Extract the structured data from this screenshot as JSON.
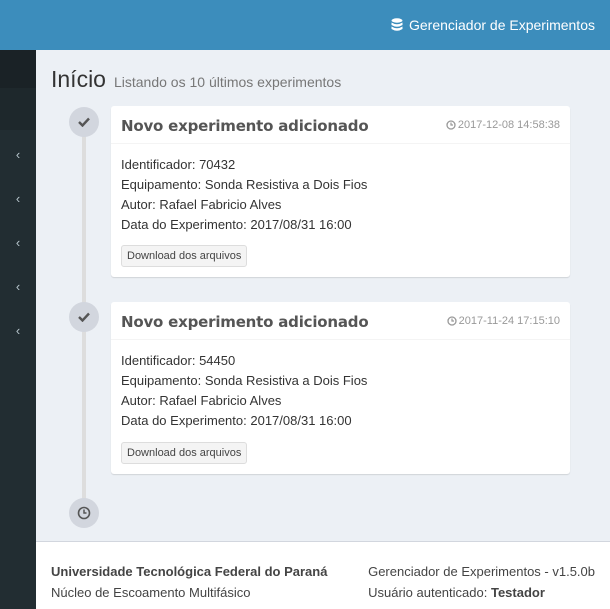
{
  "header": {
    "brand_label": "Gerenciador de Experimentos",
    "brand_icon": "database-icon",
    "color": "#3c8dbc"
  },
  "sidebar": {
    "items": [
      "chevron-left-icon",
      "chevron-left-icon",
      "chevron-left-icon",
      "chevron-left-icon",
      "chevron-left-icon"
    ],
    "bg": "#222d32"
  },
  "page": {
    "title": "Início",
    "subtitle": "Listando os 10 últimos experimentos"
  },
  "timeline": [
    {
      "title": "Novo experimento adicionado",
      "time": "2017-12-08 14:58:38",
      "id_label": "Identificador:",
      "id_value": "70432",
      "equip_label": "Equipamento:",
      "equip_value": "Sonda Resistiva a Dois Fios",
      "author_label": "Autor:",
      "author_value": "Rafael Fabricio Alves",
      "date_label": "Data do Experimento:",
      "date_value": "2017/08/31 16:00",
      "button_label": "Download dos arquivos"
    },
    {
      "title": "Novo experimento adicionado",
      "time": "2017-11-24 17:15:10",
      "id_label": "Identificador:",
      "id_value": "54450",
      "equip_label": "Equipamento:",
      "equip_value": "Sonda Resistiva a Dois Fios",
      "author_label": "Autor:",
      "author_value": "Rafael Fabricio Alves",
      "date_label": "Data do Experimento:",
      "date_value": "2017/08/31 16:00",
      "button_label": "Download dos arquivos"
    }
  ],
  "footer": {
    "university": "Universidade Tecnológica Federal do Paraná",
    "group": "Núcleo de Escoamento Multifásico",
    "app_version": "Gerenciador de Experimentos - v1.5.0b",
    "user_label": "Usuário autenticado:",
    "user_name": "Testador"
  }
}
